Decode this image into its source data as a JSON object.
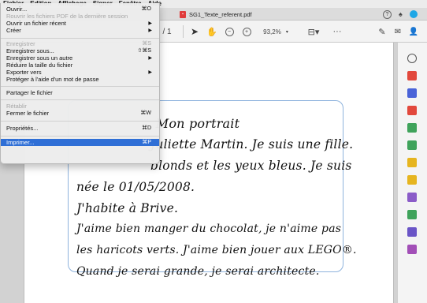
{
  "menubar": {
    "items": [
      "Fichier",
      "Edition",
      "Affichage",
      "Signer",
      "Fenêtre",
      "Aide"
    ]
  },
  "tab": {
    "title": "SG1_Texte_referent.pdf"
  },
  "toolbar": {
    "page_suffix": "/ 1",
    "zoom": "93,2%",
    "more": "···"
  },
  "menu": {
    "items": [
      {
        "label": "Ouvrir...",
        "shortcut": "⌘O"
      },
      {
        "label": "Rouvrir les fichiers PDF de la dernière session",
        "shortcut": ""
      },
      {
        "label": "Ouvrir un fichier récent",
        "shortcut": ""
      },
      {
        "label": "Créer",
        "shortcut": ""
      },
      {
        "label": "Enregistrer",
        "shortcut": "⌘S"
      },
      {
        "label": "Enregistrer sous...",
        "shortcut": "⇧⌘S"
      },
      {
        "label": "Enregistrer sous un autre",
        "shortcut": ""
      },
      {
        "label": "Réduire la taille du fichier",
        "shortcut": ""
      },
      {
        "label": "Exporter vers",
        "shortcut": ""
      },
      {
        "label": "Protéger à l'aide d'un mot de passe",
        "shortcut": ""
      },
      {
        "label": "Partager le fichier",
        "shortcut": ""
      },
      {
        "label": "Rétablir",
        "shortcut": ""
      },
      {
        "label": "Fermer le fichier",
        "shortcut": "⌘W"
      },
      {
        "label": "Propriétés...",
        "shortcut": "⌘D"
      },
      {
        "label": "Imprimer...",
        "shortcut": "⌘P"
      }
    ],
    "arrow": "▶"
  },
  "document": {
    "title": "Mon portrait",
    "lines": [
      "Juliette Martin. Je suis une fille.",
      "blonds et les yeux bleus. Je suis",
      "née le 01/05/2008.",
      "J'habite à Brive.",
      "J'aime bien manger du chocolat, je n'aime pas",
      "les haricots verts. J'aime bien jouer aux LEGO®.",
      "Quand je serai grande, je serai architecte."
    ]
  },
  "colors": {
    "menu_highlight": "#2f6fd6",
    "text_box_border": "#8eb3dd",
    "accent": "#1ea7e6"
  }
}
